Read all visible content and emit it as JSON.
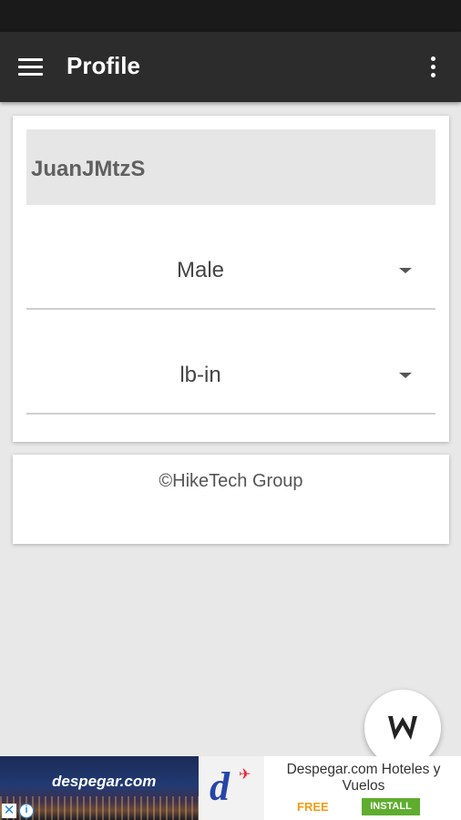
{
  "app_bar": {
    "title": "Profile",
    "menu_icon": "hamburger-menu-icon",
    "overflow_icon": "more-vert-icon",
    "background": "#2c2c2c"
  },
  "profile": {
    "username": "JuanJMtzS",
    "gender": {
      "selected": "Male"
    },
    "units": {
      "selected": "lb-in"
    }
  },
  "footer": {
    "copyright": "©HikeTech Group"
  },
  "fab": {
    "icon": "hiketech-w-logo-icon"
  },
  "ad": {
    "brand": "despegar.com",
    "logo_letter": "d",
    "title": "Despegar.com Hoteles y Vuelos",
    "price": "FREE",
    "install_label": "INSTALL",
    "close_icon": "close-icon",
    "info_icon": "info-icon",
    "install_color": "#5fad2f",
    "price_color": "#f39c12"
  }
}
